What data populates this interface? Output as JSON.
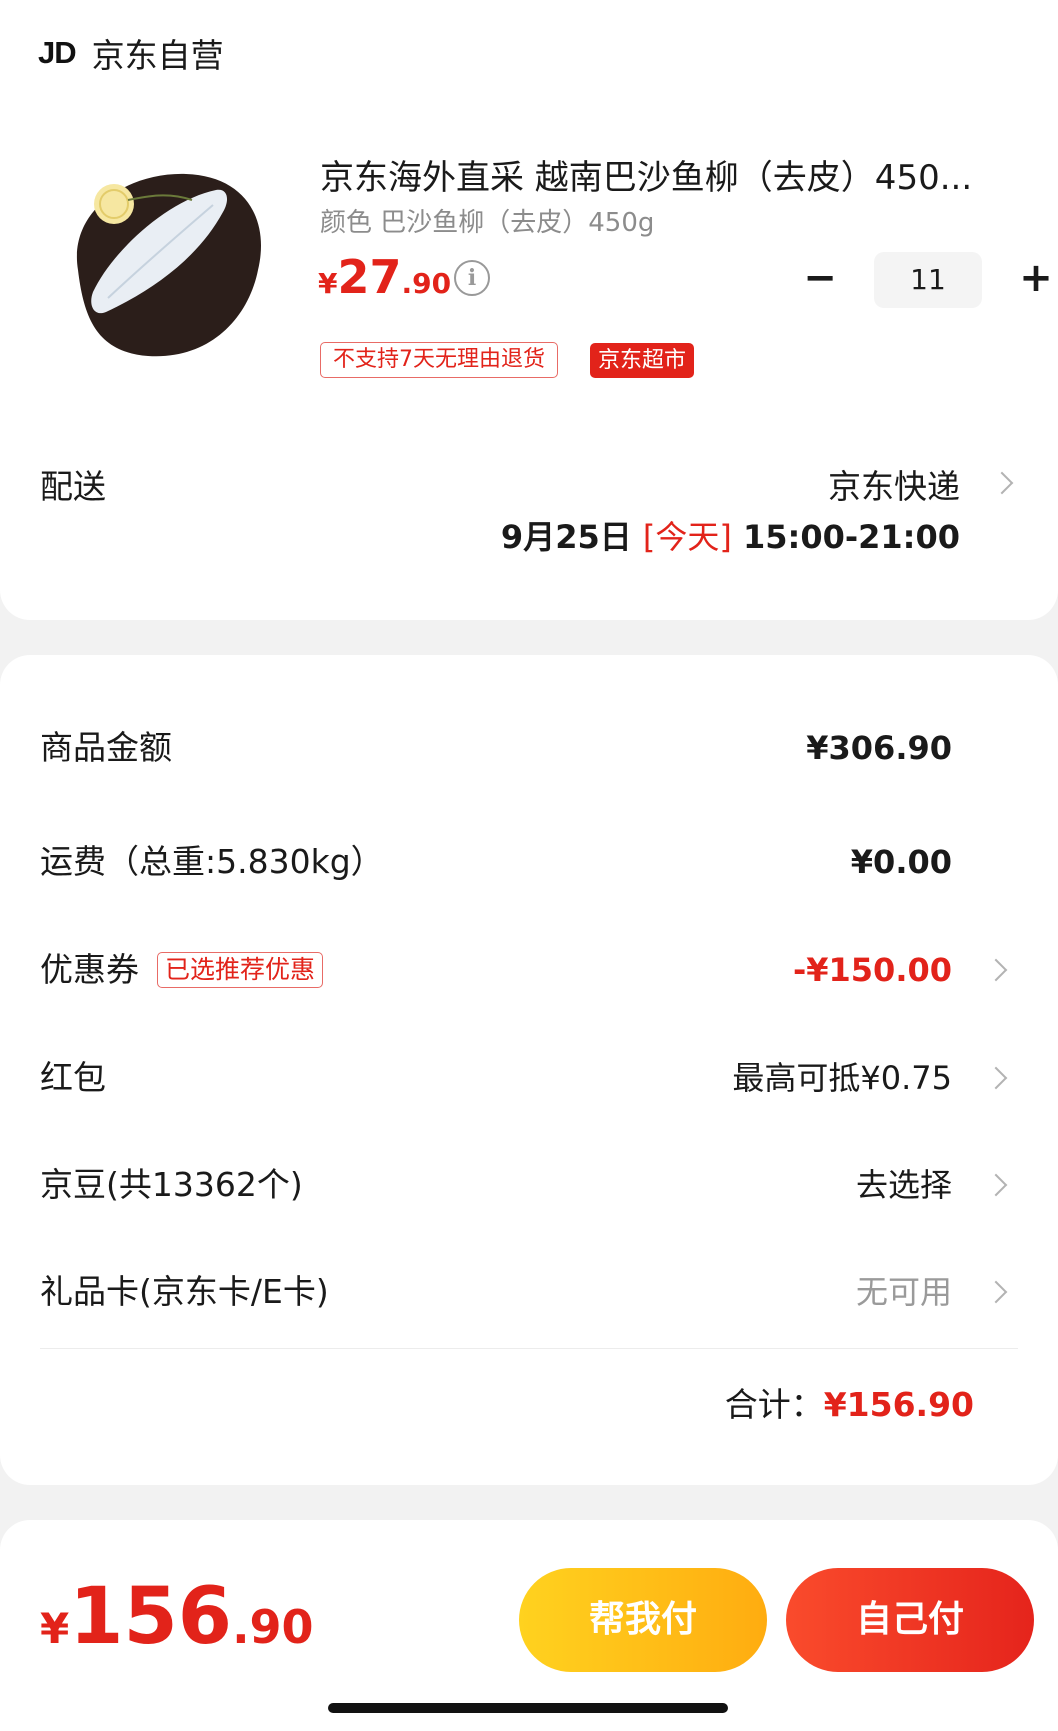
{
  "store": {
    "logo": "JD",
    "name": "京东自营"
  },
  "product": {
    "title": "京东海外直采 越南巴沙鱼柳（去皮）450...",
    "spec": "颜色 巴沙鱼柳（去皮）450g",
    "price_currency": "¥",
    "price_int": "27",
    "price_dec": ".90",
    "quantity": "11",
    "tag_return": "不支持7天无理由退货",
    "tag_market": "京东超市"
  },
  "shipping": {
    "label": "配送",
    "method": "京东快递",
    "date": "9月25日",
    "today": "[今天]",
    "time": "15:00-21:00"
  },
  "summary": {
    "goods_label": "商品金额",
    "goods_value": "¥306.90",
    "freight_label": "运费（总重:5.830kg）",
    "freight_value": "¥0.00",
    "coupon_label": "优惠券",
    "coupon_tag": "已选推荐优惠",
    "coupon_value": "-¥150.00",
    "redpacket_label": "红包",
    "redpacket_value": "最高可抵¥0.75",
    "jingdou_label": "京豆(共13362个)",
    "jingdou_value": "去选择",
    "giftcard_label": "礼品卡(京东卡/E卡)",
    "giftcard_value": "无可用",
    "total_label": "合计：",
    "total_value": "¥156.90"
  },
  "footer": {
    "currency": "¥",
    "amount_int": "156",
    "amount_dec": ".90",
    "help_pay": "帮我付",
    "self_pay": "自己付"
  },
  "colors": {
    "accent": "#e2231a",
    "help_btn": "#ffc01a",
    "self_btn": "#f0361f"
  }
}
